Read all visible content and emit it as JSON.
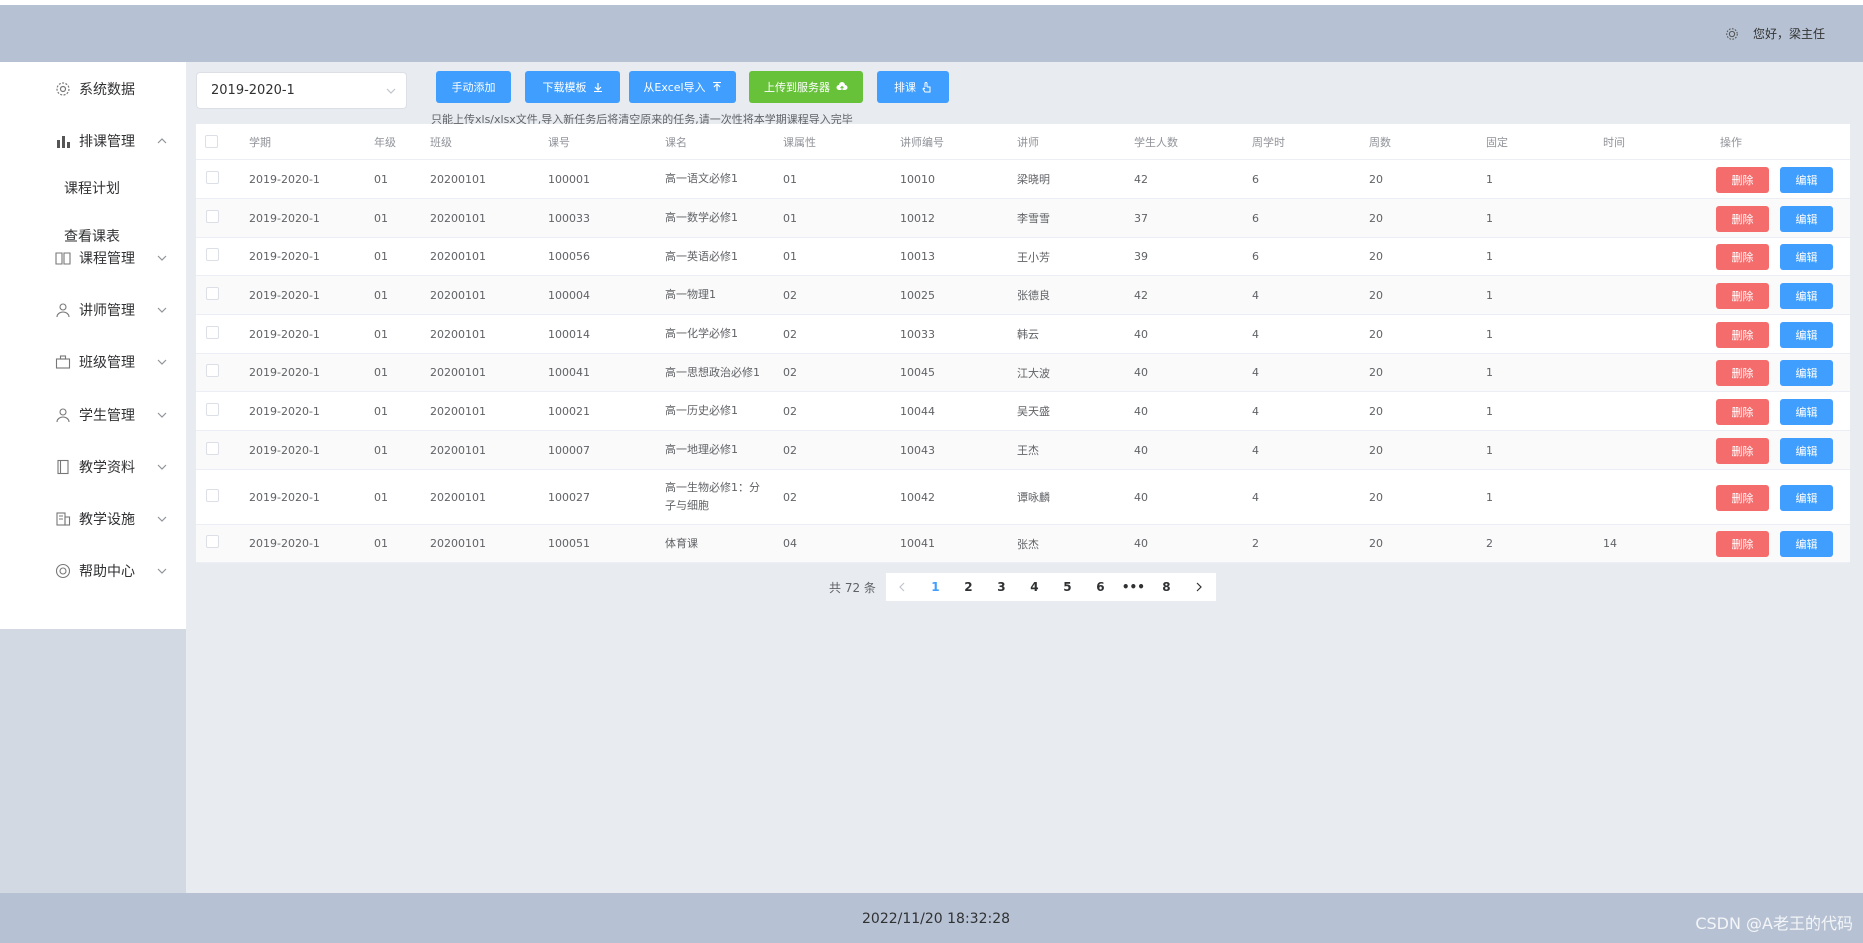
{
  "header": {
    "greeting": "您好，",
    "user": "梁主任"
  },
  "sidebar": {
    "items": [
      {
        "label": "系统数据",
        "icon": "gear-icon",
        "expanded": false,
        "chevron": false
      },
      {
        "label": "排课管理",
        "icon": "bar-chart-icon",
        "expanded": true,
        "chevron": true
      },
      {
        "label": "课程管理",
        "icon": "book-icon",
        "expanded": false,
        "chevron": true
      },
      {
        "label": "讲师管理",
        "icon": "user-icon",
        "expanded": false,
        "chevron": true
      },
      {
        "label": "班级管理",
        "icon": "briefcase-icon",
        "expanded": false,
        "chevron": true
      },
      {
        "label": "学生管理",
        "icon": "user-icon",
        "expanded": false,
        "chevron": true
      },
      {
        "label": "教学资料",
        "icon": "notebook-icon",
        "expanded": false,
        "chevron": true
      },
      {
        "label": "教学设施",
        "icon": "building-icon",
        "expanded": false,
        "chevron": true
      },
      {
        "label": "帮助中心",
        "icon": "help-icon",
        "expanded": false,
        "chevron": true
      }
    ],
    "subitems": [
      "课程计划",
      "查看课表"
    ]
  },
  "toolbar": {
    "semester": "2019-2020-1",
    "add_label": "手动添加",
    "download_label": "下载模板",
    "import_label": "从Excel导入",
    "upload_label": "上传到服务器",
    "schedule_label": "排课",
    "hint": "只能上传xls/xlsx文件,导入新任务后将清空原来的任务,请一次性将本学期课程导入完毕"
  },
  "table": {
    "headers": [
      "学期",
      "年级",
      "班级",
      "课号",
      "课名",
      "课属性",
      "讲师编号",
      "讲师",
      "学生人数",
      "周学时",
      "周数",
      "固定",
      "时间",
      "操作"
    ],
    "rows": [
      [
        "2019-2020-1",
        "01",
        "20200101",
        "100001",
        "高一语文必修1",
        "01",
        "10010",
        "梁晓明",
        "42",
        "6",
        "20",
        "1",
        ""
      ],
      [
        "2019-2020-1",
        "01",
        "20200101",
        "100033",
        "高一数学必修1",
        "01",
        "10012",
        "李雪雪",
        "37",
        "6",
        "20",
        "1",
        ""
      ],
      [
        "2019-2020-1",
        "01",
        "20200101",
        "100056",
        "高一英语必修1",
        "01",
        "10013",
        "王小芳",
        "39",
        "6",
        "20",
        "1",
        ""
      ],
      [
        "2019-2020-1",
        "01",
        "20200101",
        "100004",
        "高一物理1",
        "02",
        "10025",
        "张德良",
        "42",
        "4",
        "20",
        "1",
        ""
      ],
      [
        "2019-2020-1",
        "01",
        "20200101",
        "100014",
        "高一化学必修1",
        "02",
        "10033",
        "韩云",
        "40",
        "4",
        "20",
        "1",
        ""
      ],
      [
        "2019-2020-1",
        "01",
        "20200101",
        "100041",
        "高一思想政治必修1",
        "02",
        "10045",
        "江大波",
        "40",
        "4",
        "20",
        "1",
        ""
      ],
      [
        "2019-2020-1",
        "01",
        "20200101",
        "100021",
        "高一历史必修1",
        "02",
        "10044",
        "吴天盛",
        "40",
        "4",
        "20",
        "1",
        ""
      ],
      [
        "2019-2020-1",
        "01",
        "20200101",
        "100007",
        "高一地理必修1",
        "02",
        "10043",
        "王杰",
        "40",
        "4",
        "20",
        "1",
        ""
      ],
      [
        "2019-2020-1",
        "01",
        "20200101",
        "100027",
        "高一生物必修1：分子与细胞",
        "02",
        "10042",
        "谭咏麟",
        "40",
        "4",
        "20",
        "1",
        ""
      ],
      [
        "2019-2020-1",
        "01",
        "20200101",
        "100051",
        "体育课",
        "04",
        "10041",
        "张杰",
        "40",
        "2",
        "20",
        "2",
        "14"
      ]
    ],
    "delete_label": "删除",
    "edit_label": "编辑"
  },
  "pagination": {
    "total": "共 72 条",
    "pages": [
      "1",
      "2",
      "3",
      "4",
      "5",
      "6",
      "•••",
      "8"
    ],
    "current": "1"
  },
  "footer": {
    "datetime": "2022/11/20 18:32:28",
    "watermark": "CSDN @A老王的代码"
  },
  "colors": {
    "primary": "#409eff",
    "success": "#67c23a",
    "danger": "#f56c6c",
    "header_bg": "#b6c2d3"
  }
}
